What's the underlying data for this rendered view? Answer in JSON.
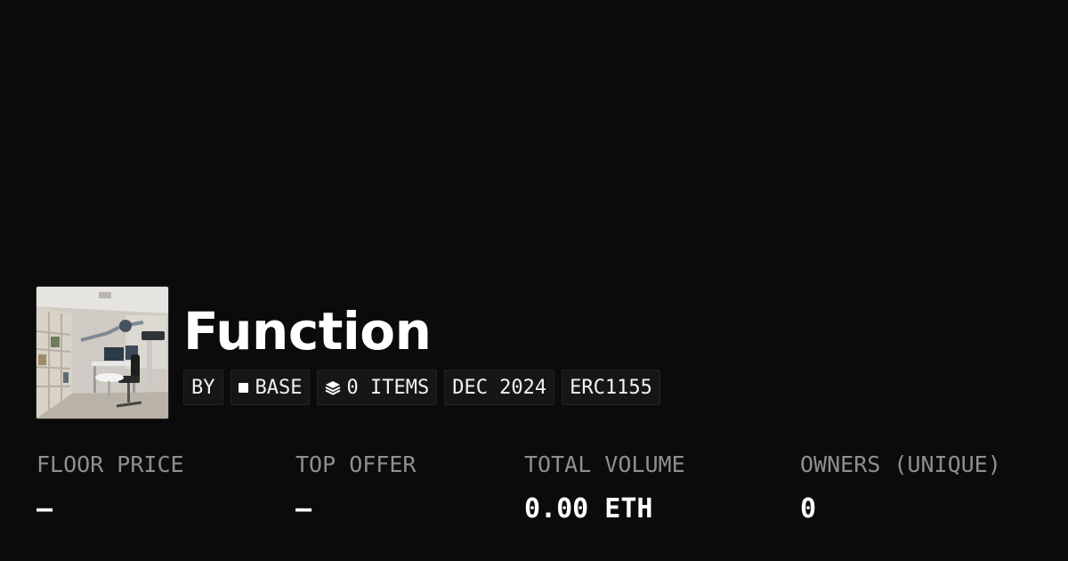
{
  "collection": {
    "title": "Function",
    "thumbnail_alt": "collection-thumbnail"
  },
  "meta": {
    "by": "BY",
    "chain": "BASE",
    "items": "0 ITEMS",
    "date": "DEC 2024",
    "standard": "ERC1155"
  },
  "stats": [
    {
      "label": "FLOOR PRICE",
      "value": "–"
    },
    {
      "label": "TOP OFFER",
      "value": "–"
    },
    {
      "label": "TOTAL VOLUME",
      "value": "0.00 ETH"
    },
    {
      "label": "OWNERS (UNIQUE)",
      "value": "0"
    }
  ],
  "colors": {
    "background": "#0b0b0b",
    "label": "#8f8f8f",
    "pill_bg": "#161616"
  },
  "icons": [
    "chain-square-icon",
    "layers-icon"
  ]
}
